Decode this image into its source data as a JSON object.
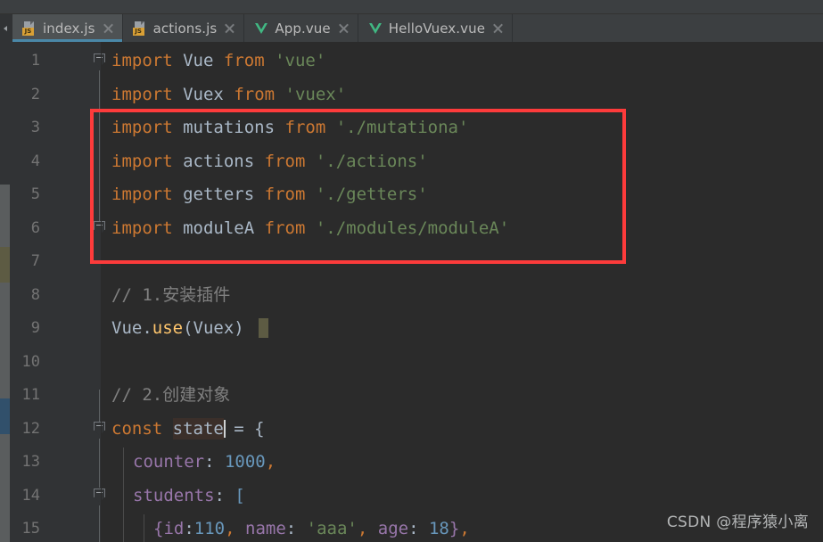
{
  "window": {
    "theme": "darcula",
    "bg": "#2b2b2b",
    "gutter_bg": "#313335",
    "tabbar_bg": "#3c3f41",
    "active_tab_bg": "#4e5254",
    "active_tab_underline": "#4a88a8",
    "annotation_color": "#fd3b3b"
  },
  "tabs": [
    {
      "label": "index.js",
      "icon": "js-file-icon",
      "badge": "JS",
      "active": true
    },
    {
      "label": "actions.js",
      "icon": "js-file-icon",
      "badge": "JS",
      "active": false
    },
    {
      "label": "App.vue",
      "icon": "vue-file-icon",
      "badge": "",
      "active": false
    },
    {
      "label": "HelloVuex.vue",
      "icon": "vue-file-icon",
      "badge": "",
      "active": false
    }
  ],
  "editor": {
    "file": "index.js",
    "line_numbers": [
      "1",
      "2",
      "3",
      "4",
      "5",
      "6",
      "7",
      "8",
      "9",
      "10",
      "11",
      "12",
      "13",
      "14",
      "15"
    ],
    "lines": [
      {
        "n": "1",
        "text": "import Vue from 'vue'"
      },
      {
        "n": "2",
        "text": "import Vuex from 'vuex'"
      },
      {
        "n": "3",
        "text": "import mutations from './mutationa'"
      },
      {
        "n": "4",
        "text": "import actions from './actions'"
      },
      {
        "n": "5",
        "text": "import getters from './getters'"
      },
      {
        "n": "6",
        "text": "import moduleA from './modules/moduleA'"
      },
      {
        "n": "7",
        "text": ""
      },
      {
        "n": "8",
        "text": "// 1.安装插件"
      },
      {
        "n": "9",
        "text": "Vue.use(Vuex)"
      },
      {
        "n": "10",
        "text": ""
      },
      {
        "n": "11",
        "text": "// 2.创建对象"
      },
      {
        "n": "12",
        "text": "const state = {"
      },
      {
        "n": "13",
        "text": "  counter: 1000,"
      },
      {
        "n": "14",
        "text": "  students: ["
      },
      {
        "n": "15",
        "text": "    {id:110, name: 'aaa', age: 18},"
      }
    ],
    "tokens": {
      "import": "import",
      "from": "from",
      "const": "const",
      "vue_ident": "Vue",
      "vuex_ident": "Vuex",
      "mutations_ident": "mutations",
      "actions_ident": "actions",
      "getters_ident": "getters",
      "moduleA_ident": "moduleA",
      "str_vue": "'vue'",
      "str_vuex": "'vuex'",
      "str_mutationa": "'./mutationa'",
      "str_actions": "'./actions'",
      "str_getters": "'./getters'",
      "str_moduleA": "'./modules/moduleA'",
      "comment_1": "// 1.安装插件",
      "comment_2": "// 2.创建对象",
      "use_call_obj": "Vue.",
      "use_call_fn": "use",
      "use_call_args": "(Vuex)",
      "state_ident": "state",
      "state_eq": " = {",
      "counter_key": "counter",
      "counter_val": "1000",
      "students_key": "students",
      "students_open": "[",
      "student_id_key": "id",
      "student_id_val": "110",
      "student_name_key": "name",
      "student_name_val": "'aaa'",
      "student_age_key": "age",
      "student_age_val": "18"
    },
    "colors": {
      "keyword": "#cc7832",
      "identifier": "#a9b7c6",
      "string": "#6a8759",
      "number": "#6897bb",
      "comment": "#808080",
      "property": "#9876aa",
      "function": "#ffc66d",
      "ident_highlight": "#3b2f2a",
      "block_highlight": "#5d5b43"
    }
  },
  "watermark": {
    "text": "CSDN @程序猿小离"
  }
}
